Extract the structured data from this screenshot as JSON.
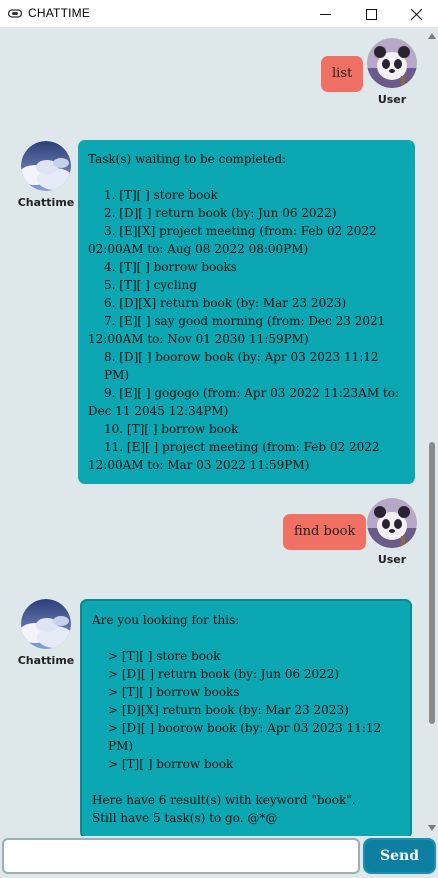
{
  "window": {
    "title": "CHATTIME"
  },
  "colors": {
    "chat_background": "#dee7ea",
    "user_bubble": "#f07063",
    "bot_bubble": "#0ba8b3",
    "send_button": "#0d7fa0"
  },
  "icons": {
    "app": "link-icon",
    "minimize": "minimize-icon",
    "maximize": "maximize-icon",
    "close": "close-icon",
    "user_avatar": "panda-avatar",
    "bot_avatar": "clouds-avatar"
  },
  "messages": [
    {
      "sender": "User",
      "text": "list"
    },
    {
      "sender": "Chattime",
      "header": "Task(s) waiting to be completed:",
      "items": [
        "1. [T][ ] store book",
        "2. [D][ ] return book (by: Jun 06 2022)",
        "3. [E][X] project meeting (from: Feb 02 2022 02:00AM to: Aug 08 2022 08:00PM)",
        "4. [T][ ] borrow books",
        "5. [T][ ] cycling",
        "6. [D][X] return book (by: Mar 23 2023)",
        "7. [E][ ] say good morning (from: Dec 23 2021 12:00AM to: Nov 01 2030 11:59PM)",
        "8. [D][ ] boorow book (by: Apr 03 2023 11:12 PM)",
        "9. [E][ ] gogogo (from: Apr 03 2022 11:23AM to: Dec 11 2045 12:34PM)",
        "10. [T][ ] borrow book",
        "11. [E][ ] project meeting (from: Feb 02 2022 12:00AM to: Mar 03 2022 11:59PM)"
      ]
    },
    {
      "sender": "User",
      "text": "find book"
    },
    {
      "sender": "Chattime",
      "header": "Are you looking for this:",
      "items": [
        "> [T][ ] store book",
        "> [D][ ] return book (by: Jun 06 2022)",
        "> [T][ ] borrow books",
        "> [D][X] return book (by: Mar 23 2023)",
        "> [D][ ] boorow book (by: Apr 03 2023 11:12 PM)",
        "> [T][ ] borrow book"
      ],
      "footer": [
        "Here have 6 result(s) with keyword \"book\".",
        "Still have 5 task(s) to go. @*@"
      ]
    }
  ],
  "input": {
    "value": "",
    "placeholder": ""
  },
  "send_label": "Send"
}
